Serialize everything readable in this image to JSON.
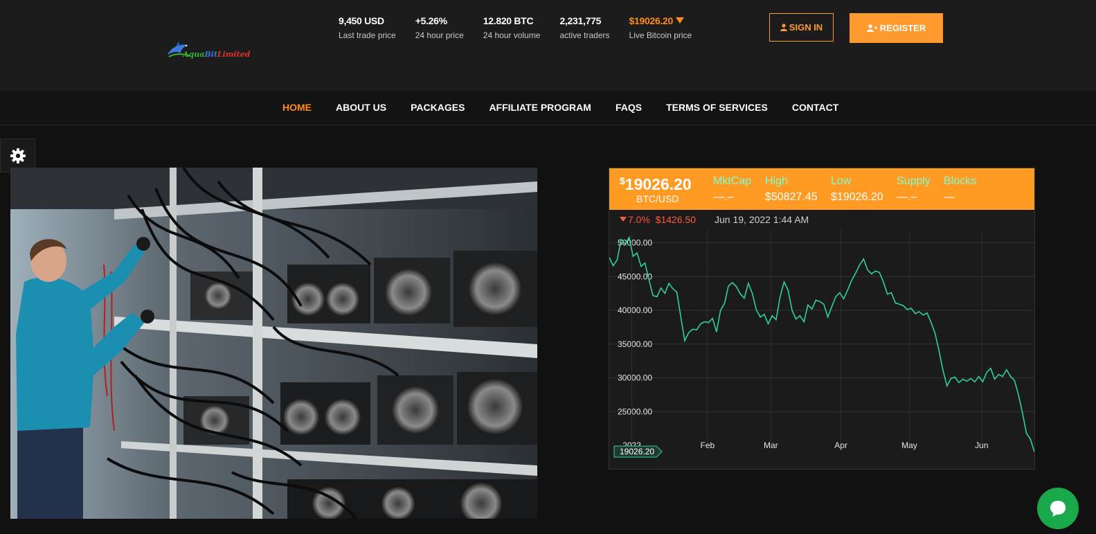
{
  "header": {
    "logo_text_1": "Aqua",
    "logo_text_2": "Bit",
    "logo_text_3": "Limited",
    "stats": [
      {
        "value": "9,450 USD",
        "label": "Last trade price"
      },
      {
        "value": "+5.26%",
        "label": "24 hour price"
      },
      {
        "value": "12.820 BTC",
        "label": "24 hour volume"
      },
      {
        "value": "2,231,775",
        "label": "active traders"
      },
      {
        "value": "$19026.20",
        "label": "Live Bitcoin price"
      }
    ],
    "sign_in_label": "SIGN IN",
    "register_label": "REGISTER",
    "sign_in_icon": "user-icon",
    "register_icon": "user-plus-icon"
  },
  "nav": {
    "items": [
      "HOME",
      "ABOUT US",
      "PACKAGES",
      "AFFILIATE PROGRAM",
      "FAQS",
      "TERMS OF SERVICES",
      "CONTACT"
    ],
    "active": "HOME"
  },
  "widget": {
    "price": "19026.20",
    "currency_symbol": "$",
    "pair": "BTC/USD",
    "mktcap_label": "MktCap",
    "mktcap_value": "—.–",
    "high_label": "High",
    "high_value": "$50827.45",
    "low_label": "Low",
    "low_value": "$19026.20",
    "supply_label": "Supply",
    "supply_value": "—.–",
    "blocks_label": "Blocks",
    "blocks_value": "—",
    "change_percent": "7.0%",
    "change_amount": "$1426.50",
    "date": "Jun 19, 2022 1:44 AM",
    "current_marker": "19026.20"
  },
  "colors": {
    "accent": "#ff9b23",
    "line": "#2fd39a",
    "down": "#ff5a3c",
    "chat": "#19a84a"
  },
  "chart_data": {
    "type": "line",
    "x_ticks": [
      "2022",
      "Feb",
      "Mar",
      "Apr",
      "May",
      "Jun"
    ],
    "y_ticks": [
      "50000.00",
      "45000.00",
      "40000.00",
      "35000.00",
      "30000.00",
      "25000.00"
    ],
    "ylim": [
      20000,
      52000
    ],
    "grid": true,
    "series": [
      {
        "values": [
          [
            0,
            47800
          ],
          [
            2,
            46600
          ],
          [
            4,
            47500
          ],
          [
            6,
            50500
          ],
          [
            8,
            49800
          ],
          [
            10,
            50800
          ],
          [
            12,
            48000
          ],
          [
            14,
            48500
          ],
          [
            16,
            46500
          ],
          [
            18,
            47000
          ],
          [
            20,
            44500
          ],
          [
            22,
            42200
          ],
          [
            24,
            42000
          ],
          [
            26,
            43300
          ],
          [
            28,
            42500
          ],
          [
            30,
            44000
          ],
          [
            32,
            43200
          ],
          [
            34,
            42700
          ],
          [
            36,
            39000
          ],
          [
            38,
            35500
          ],
          [
            40,
            36700
          ],
          [
            42,
            37200
          ],
          [
            44,
            37100
          ],
          [
            46,
            38000
          ],
          [
            48,
            38300
          ],
          [
            50,
            38200
          ],
          [
            52,
            38800
          ],
          [
            54,
            36800
          ],
          [
            56,
            40000
          ],
          [
            58,
            41000
          ],
          [
            60,
            43600
          ],
          [
            62,
            44100
          ],
          [
            64,
            43500
          ],
          [
            66,
            42400
          ],
          [
            68,
            41800
          ],
          [
            70,
            44000
          ],
          [
            72,
            42500
          ],
          [
            74,
            40100
          ],
          [
            76,
            39000
          ],
          [
            78,
            39400
          ],
          [
            80,
            38000
          ],
          [
            82,
            39200
          ],
          [
            84,
            38600
          ],
          [
            86,
            42000
          ],
          [
            88,
            44200
          ],
          [
            90,
            43000
          ],
          [
            92,
            40000
          ],
          [
            94,
            38700
          ],
          [
            96,
            39200
          ],
          [
            98,
            38300
          ],
          [
            100,
            40800
          ],
          [
            102,
            40200
          ],
          [
            104,
            41500
          ],
          [
            106,
            41300
          ],
          [
            108,
            40900
          ],
          [
            110,
            39000
          ],
          [
            112,
            40500
          ],
          [
            114,
            42000
          ],
          [
            116,
            42600
          ],
          [
            118,
            41700
          ],
          [
            120,
            43000
          ],
          [
            122,
            44400
          ],
          [
            124,
            45500
          ],
          [
            126,
            46700
          ],
          [
            128,
            47600
          ],
          [
            130,
            46000
          ],
          [
            132,
            45400
          ],
          [
            134,
            45800
          ],
          [
            136,
            45600
          ],
          [
            138,
            44200
          ],
          [
            140,
            42400
          ],
          [
            142,
            42600
          ],
          [
            144,
            41100
          ],
          [
            146,
            40900
          ],
          [
            148,
            40700
          ],
          [
            150,
            40100
          ],
          [
            152,
            40300
          ],
          [
            154,
            39500
          ],
          [
            156,
            39800
          ],
          [
            158,
            39300
          ],
          [
            160,
            39600
          ],
          [
            162,
            38200
          ],
          [
            164,
            36600
          ],
          [
            166,
            34000
          ],
          [
            168,
            31100
          ],
          [
            170,
            28800
          ],
          [
            172,
            29900
          ],
          [
            174,
            30100
          ],
          [
            176,
            29300
          ],
          [
            178,
            29800
          ],
          [
            180,
            29500
          ],
          [
            182,
            29900
          ],
          [
            184,
            29400
          ],
          [
            186,
            30200
          ],
          [
            188,
            29400
          ],
          [
            190,
            30800
          ],
          [
            192,
            31400
          ],
          [
            194,
            29800
          ],
          [
            196,
            30500
          ],
          [
            198,
            30200
          ],
          [
            200,
            31200
          ],
          [
            202,
            30200
          ],
          [
            204,
            29600
          ],
          [
            206,
            27500
          ],
          [
            208,
            24800
          ],
          [
            210,
            21800
          ],
          [
            212,
            20900
          ],
          [
            214,
            19026
          ]
        ]
      }
    ]
  }
}
